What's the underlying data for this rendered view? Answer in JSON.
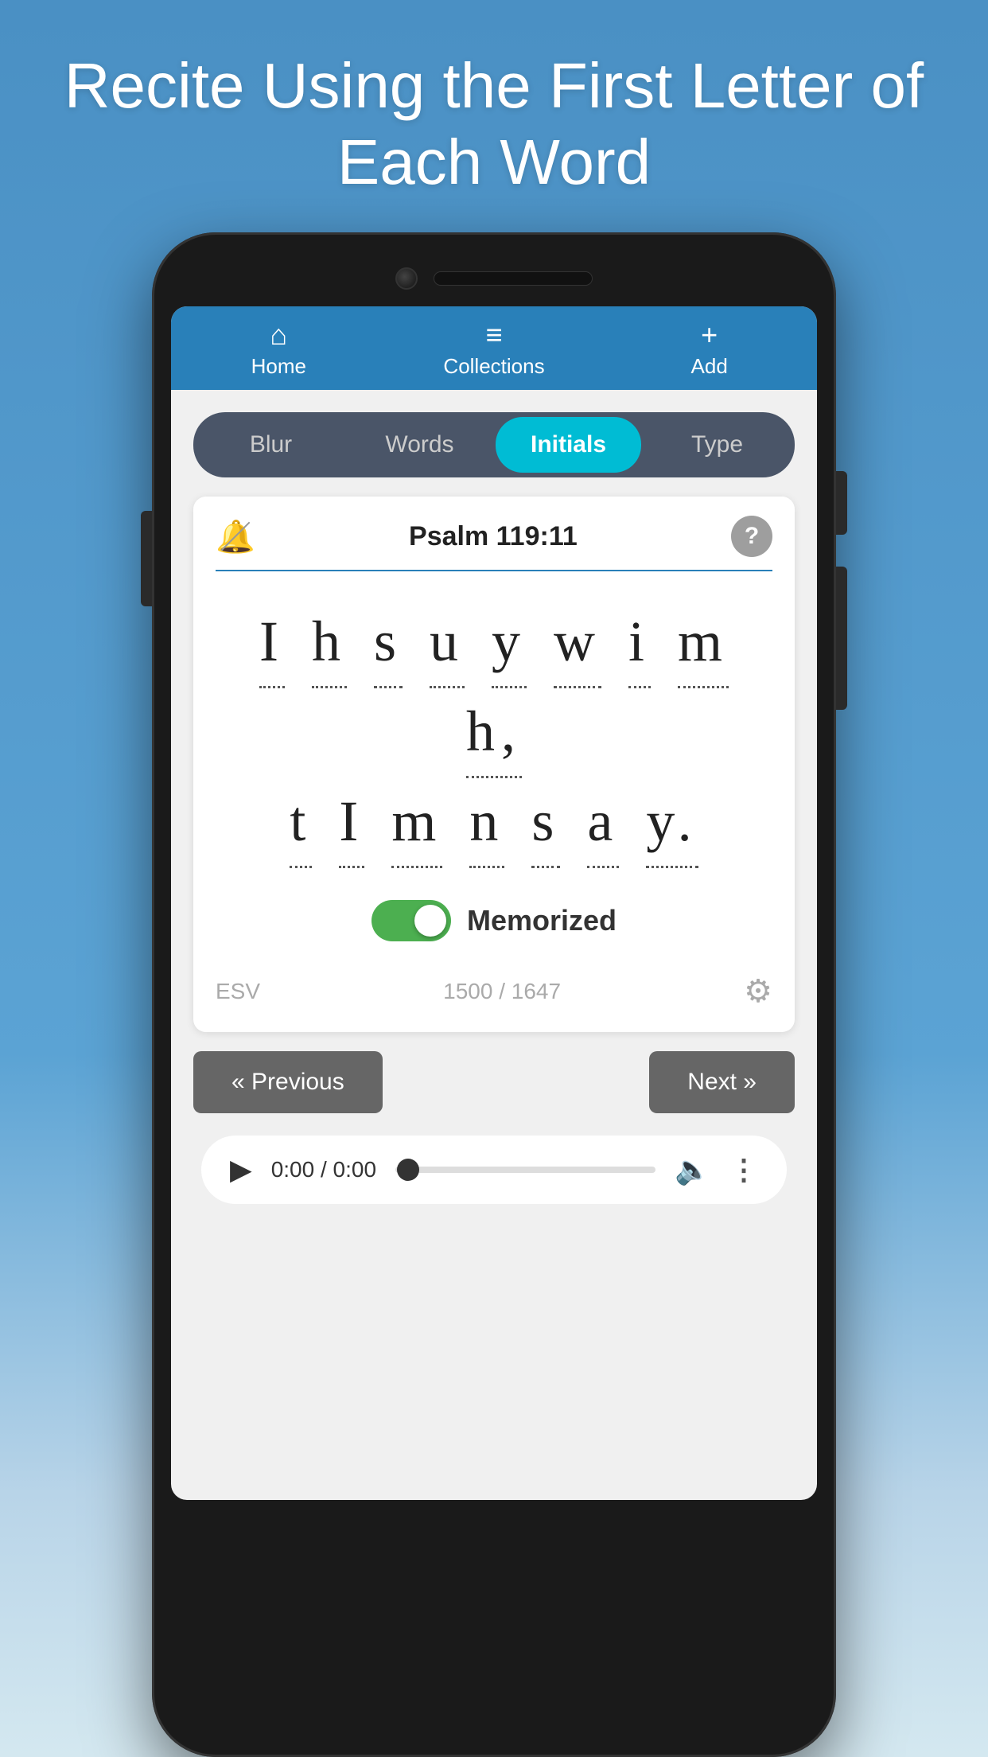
{
  "header": {
    "title": "Recite Using the First Letter of Each Word"
  },
  "nav": {
    "home_label": "Home",
    "home_icon": "⌂",
    "collections_label": "Collections",
    "collections_icon": "≡",
    "add_label": "Add",
    "add_icon": "+"
  },
  "tabs": [
    {
      "id": "blur",
      "label": "Blur",
      "active": false
    },
    {
      "id": "words",
      "label": "Words",
      "active": false
    },
    {
      "id": "initials",
      "label": "Initials",
      "active": true
    },
    {
      "id": "type",
      "label": "Type",
      "active": false
    }
  ],
  "verse": {
    "reference": "Psalm 119:11",
    "initials_line1": "I h s u y w i m h,",
    "initials_line2": "t I m n s a y.",
    "memorized_label": "Memorized",
    "version": "ESV",
    "progress": "1500 / 1647"
  },
  "navigation": {
    "previous_label": "« Previous",
    "next_label": "Next »"
  },
  "audio": {
    "time": "0:00 / 0:00"
  }
}
